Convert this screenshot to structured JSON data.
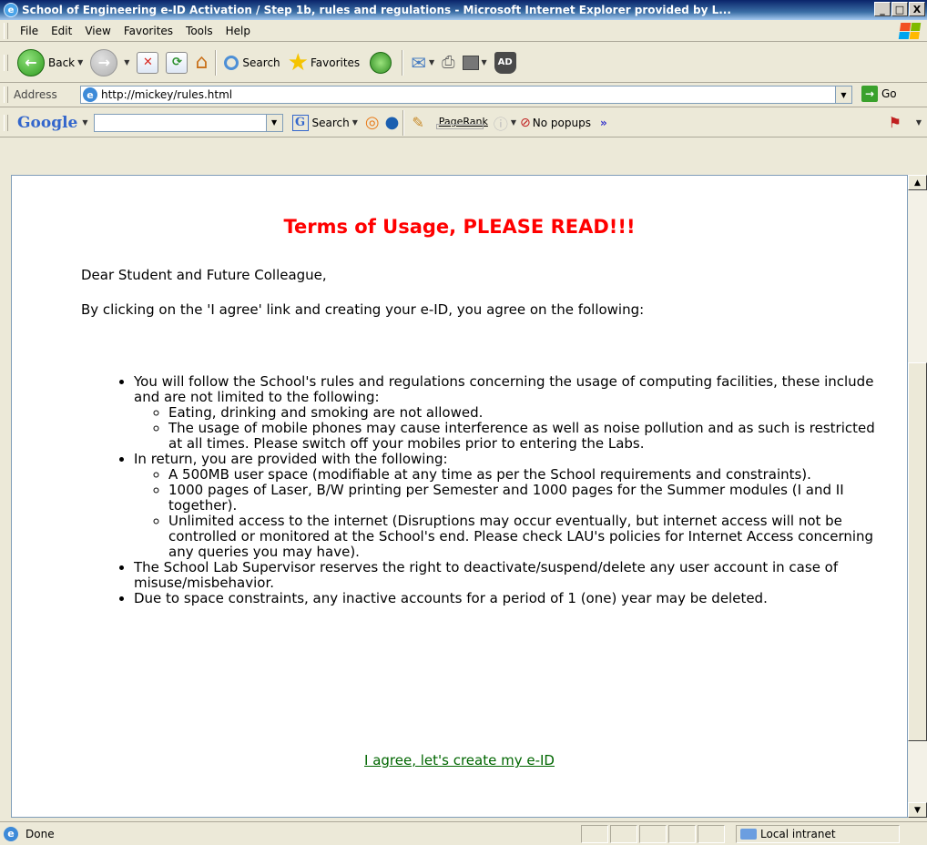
{
  "window": {
    "title": "School of Engineering e-ID Activation / Step 1b, rules and regulations - Microsoft Internet Explorer provided by L...",
    "buttons": {
      "minimize": "_",
      "maximize": "□",
      "close": "X"
    }
  },
  "menu": [
    "File",
    "Edit",
    "View",
    "Favorites",
    "Tools",
    "Help"
  ],
  "toolbar": {
    "back_label": "Back",
    "search_label": "Search",
    "favorites_label": "Favorites",
    "ad_label": "AD"
  },
  "address": {
    "label": "Address",
    "url": "http://mickey/rules.html",
    "go_label": "Go"
  },
  "google": {
    "logo": "Google",
    "search_label": "Search",
    "pagerank_label": "PageRank",
    "popups_label": "No popups",
    "more": "»"
  },
  "page": {
    "heading": "Terms of Usage, PLEASE READ!!!",
    "greeting": "Dear Student and Future Colleague,",
    "intro": "By clicking on the 'I agree' link and creating your e-ID, you agree on the following:",
    "rules": [
      {
        "text": "You will follow the School's rules and regulations concerning the usage of computing facilities, these include and are not limited to the following:",
        "sub": [
          "Eating, drinking and smoking are not allowed.",
          "The usage of mobile phones may cause interference as well as noise pollution and as such is restricted at all times. Please switch off your mobiles prior to entering the Labs."
        ]
      },
      {
        "text": "In return, you are provided with the following:",
        "sub": [
          "A 500MB user space (modifiable at any time as per the School requirements and constraints).",
          "1000 pages of Laser, B/W printing per Semester and 1000 pages for the Summer modules (I and II together).",
          "Unlimited access to the internet (Disruptions may occur eventually, but internet access will not be controlled or monitored at the School's end. Please check LAU's policies for Internet Access concerning any queries you may have)."
        ]
      },
      {
        "text": "The School Lab Supervisor reserves the right to deactivate/suspend/delete any user account in case of misuse/misbehavior.",
        "sub": []
      },
      {
        "text": "Due to space constraints, any inactive accounts for a period of 1 (one) year may be deleted.",
        "sub": []
      }
    ],
    "agree_link": "I agree, let's create my e-ID"
  },
  "status": {
    "text": "Done",
    "zone": "Local intranet"
  },
  "colors": {
    "heading": "#ff0000",
    "link": "#006600"
  }
}
